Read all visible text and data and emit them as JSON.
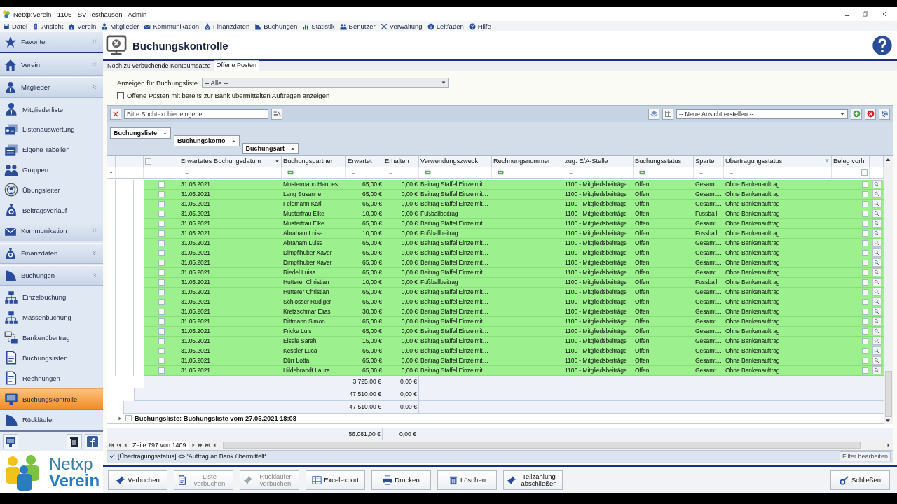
{
  "window": {
    "title": "Netxp:Verein - 1105 - SV Testhausen - Admin"
  },
  "menu": [
    "Datei",
    "Ansicht",
    "Verein",
    "Mitglieder",
    "Kommunikation",
    "Finanzdaten",
    "Buchungen",
    "Statistik",
    "Benutzer",
    "Verwaltung",
    "Leitfäden",
    "Hilfe"
  ],
  "sidebar": {
    "sections": [
      {
        "label": "Favoriten",
        "expanded": false
      },
      {
        "label": "Verein",
        "expanded": false
      },
      {
        "label": "Mitglieder",
        "expanded": true,
        "items": [
          {
            "label": "Mitgliederliste",
            "selected": false
          },
          {
            "label": "Listenauswertung",
            "selected": false
          },
          {
            "label": "Eigene Tabellen",
            "selected": false
          },
          {
            "label": "Gruppen",
            "selected": false
          },
          {
            "label": "Übungsleiter",
            "selected": false
          },
          {
            "label": "Beitragsverlauf",
            "selected": false
          }
        ]
      },
      {
        "label": "Kommunikation",
        "expanded": false
      },
      {
        "label": "Finanzdaten",
        "expanded": false
      },
      {
        "label": "Buchungen",
        "expanded": true,
        "items": [
          {
            "label": "Einzelbuchung",
            "selected": false
          },
          {
            "label": "Massenbuchung",
            "selected": false
          },
          {
            "label": "Bankenübertrag",
            "selected": false
          },
          {
            "label": "Buchungslisten",
            "selected": false
          },
          {
            "label": "Rechnungen",
            "selected": false
          },
          {
            "label": "Buchungskontrolle",
            "selected": true
          },
          {
            "label": "Rückläufer",
            "selected": false
          }
        ]
      }
    ]
  },
  "logo": {
    "top": "Netxp",
    "bottom": "Verein"
  },
  "page": {
    "title": "Buchungskontrolle"
  },
  "tabs": [
    {
      "label": "Noch zu verbuchende Kontoumsätze",
      "selected": false
    },
    {
      "label": "Offene Posten",
      "selected": true
    }
  ],
  "filter": {
    "label": "Anzeigen für Buchungsliste",
    "value": "-- Alle --"
  },
  "option": {
    "label": "Offene Posten mit bereits zur Bank übermittelten Aufträgen anzeigen",
    "checked": false
  },
  "search": {
    "placeholder": "Bitte Suchtext hier eingeben..."
  },
  "view_select": {
    "value": "-- Neue Ansicht erstellen --"
  },
  "group_by": [
    "Buchungsliste",
    "Buchungskonto",
    "Buchungsart"
  ],
  "table": {
    "all_checked": false,
    "columns": [
      {
        "label": "Erwartetes Buchungsdatum",
        "sorted": true,
        "filtered": false,
        "filter": {
          "kind": "operator",
          "text": "="
        }
      },
      {
        "label": "Buchungspartner",
        "sorted": false,
        "filtered": false,
        "filter": {
          "kind": "contains"
        }
      },
      {
        "label": "Erwartet",
        "sorted": false,
        "filtered": false,
        "filter": {
          "kind": "operator",
          "text": "="
        }
      },
      {
        "label": "Erhalten",
        "sorted": false,
        "filtered": false,
        "filter": {
          "kind": "operator",
          "text": "="
        }
      },
      {
        "label": "Verwendungszweck",
        "sorted": false,
        "filtered": false,
        "filter": {
          "kind": "contains"
        }
      },
      {
        "label": "Rechnungsnummer",
        "sorted": false,
        "filtered": false,
        "filter": {
          "kind": "contains"
        }
      },
      {
        "label": "zug. E/A-Stelle",
        "sorted": false,
        "filtered": false,
        "filter": {
          "kind": "operator",
          "text": "="
        }
      },
      {
        "label": "Buchungsstatus",
        "sorted": false,
        "filtered": false,
        "filter": {
          "kind": "contains"
        }
      },
      {
        "label": "Sparte",
        "sorted": false,
        "filtered": false,
        "filter": {
          "kind": "operator",
          "text": "="
        }
      },
      {
        "label": "Übertragungsstatus",
        "sorted": false,
        "filtered": true,
        "filter": {
          "kind": "operator",
          "text": "="
        }
      },
      {
        "label": "Beleg vorh",
        "sorted": false,
        "filtered": false,
        "filter": {
          "kind": "checkbox",
          "checked": false
        }
      }
    ],
    "rows": [
      {
        "checked": false,
        "date": "31.05.2021",
        "partner": "Mustermann Hannes",
        "expected": "65,00 €",
        "received": "0,00 €",
        "purpose": "Beitrag Staffel Einzelmit…",
        "account": "1100 - Mitgliedsbeiträge",
        "status": "Offen",
        "division": "Gesamt…",
        "transfer": "Ohne Bankenauftrag",
        "document": false
      },
      {
        "checked": false,
        "date": "31.05.2021",
        "partner": "Lang Susanne",
        "expected": "65,00 €",
        "received": "0,00 €",
        "purpose": "Beitrag Staffel Einzelmit…",
        "account": "1100 - Mitgliedsbeiträge",
        "status": "Offen",
        "division": "Gesamt…",
        "transfer": "Ohne Bankenauftrag",
        "document": false
      },
      {
        "checked": false,
        "date": "31.05.2021",
        "partner": "Feldmann Karl",
        "expected": "65,00 €",
        "received": "0,00 €",
        "purpose": "Beitrag Staffel Einzelmit…",
        "account": "1100 - Mitgliedsbeiträge",
        "status": "Offen",
        "division": "Gesamt…",
        "transfer": "Ohne Bankenauftrag",
        "document": false
      },
      {
        "checked": false,
        "date": "31.05.2021",
        "partner": "Musterfrau Elke",
        "expected": "10,00 €",
        "received": "0,00 €",
        "purpose": "Fußballbeitrag",
        "account": "1100 - Mitgliedsbeiträge",
        "status": "Offen",
        "division": "Fussball",
        "transfer": "Ohne Bankenauftrag",
        "document": false
      },
      {
        "checked": false,
        "date": "31.05.2021",
        "partner": "Musterfrau Elke",
        "expected": "65,00 €",
        "received": "0,00 €",
        "purpose": "Beitrag Staffel Einzelmit…",
        "account": "1100 - Mitgliedsbeiträge",
        "status": "Offen",
        "division": "Gesamt…",
        "transfer": "Ohne Bankenauftrag",
        "document": false
      },
      {
        "checked": false,
        "date": "31.05.2021",
        "partner": "Abraham Luise",
        "expected": "10,00 €",
        "received": "0,00 €",
        "purpose": "Fußballbeitrag",
        "account": "1100 - Mitgliedsbeiträge",
        "status": "Offen",
        "division": "Fussball",
        "transfer": "Ohne Bankenauftrag",
        "document": false
      },
      {
        "checked": false,
        "date": "31.05.2021",
        "partner": "Abraham Luise",
        "expected": "65,00 €",
        "received": "0,00 €",
        "purpose": "Beitrag Staffel Einzelmit…",
        "account": "1100 - Mitgliedsbeiträge",
        "status": "Offen",
        "division": "Gesamt…",
        "transfer": "Ohne Bankenauftrag",
        "document": false
      },
      {
        "checked": false,
        "date": "31.05.2021",
        "partner": "Dimpflhuber Xaver",
        "expected": "65,00 €",
        "received": "0,00 €",
        "purpose": "Beitrag Staffel Einzelmit…",
        "account": "1100 - Mitgliedsbeiträge",
        "status": "Offen",
        "division": "Gesamt…",
        "transfer": "Ohne Bankenauftrag",
        "document": false
      },
      {
        "checked": false,
        "date": "31.05.2021",
        "partner": "Dimpflhuber Xaver",
        "expected": "65,00 €",
        "received": "0,00 €",
        "purpose": "Beitrag Staffel Einzelmit…",
        "account": "1100 - Mitgliedsbeiträge",
        "status": "Offen",
        "division": "Gesamt…",
        "transfer": "Ohne Bankenauftrag",
        "document": false
      },
      {
        "checked": false,
        "date": "31.05.2021",
        "partner": "Riedel Luisa",
        "expected": "65,00 €",
        "received": "0,00 €",
        "purpose": "Beitrag Staffel Einzelmit…",
        "account": "1100 - Mitgliedsbeiträge",
        "status": "Offen",
        "division": "Gesamt…",
        "transfer": "Ohne Bankenauftrag",
        "document": false
      },
      {
        "checked": false,
        "date": "31.05.2021",
        "partner": "Hutterer Christian",
        "expected": "10,00 €",
        "received": "0,00 €",
        "purpose": "Fußballbeitrag",
        "account": "1100 - Mitgliedsbeiträge",
        "status": "Offen",
        "division": "Fussball",
        "transfer": "Ohne Bankenauftrag",
        "document": false
      },
      {
        "checked": false,
        "date": "31.05.2021",
        "partner": "Hutterer Christian",
        "expected": "65,00 €",
        "received": "0,00 €",
        "purpose": "Beitrag Staffel Einzelmit…",
        "account": "1100 - Mitgliedsbeiträge",
        "status": "Offen",
        "division": "Gesamt…",
        "transfer": "Ohne Bankenauftrag",
        "document": false
      },
      {
        "checked": false,
        "date": "31.05.2021",
        "partner": "Schlosser Rüdiger",
        "expected": "65,00 €",
        "received": "0,00 €",
        "purpose": "Beitrag Staffel Einzelmit…",
        "account": "1100 - Mitgliedsbeiträge",
        "status": "Offen",
        "division": "Gesamt…",
        "transfer": "Ohne Bankenauftrag",
        "document": false
      },
      {
        "checked": false,
        "date": "31.05.2021",
        "partner": "Kretzschmar Elias",
        "expected": "30,00 €",
        "received": "0,00 €",
        "purpose": "Beitrag Staffel Einzelmit…",
        "account": "1100 - Mitgliedsbeiträge",
        "status": "Offen",
        "division": "Gesamt…",
        "transfer": "Ohne Bankenauftrag",
        "document": false
      },
      {
        "checked": false,
        "date": "31.05.2021",
        "partner": "Dittmann Simon",
        "expected": "65,00 €",
        "received": "0,00 €",
        "purpose": "Beitrag Staffel Einzelmit…",
        "account": "1100 - Mitgliedsbeiträge",
        "status": "Offen",
        "division": "Gesamt…",
        "transfer": "Ohne Bankenauftrag",
        "document": false
      },
      {
        "checked": false,
        "date": "31.05.2021",
        "partner": "Fricke Luis",
        "expected": "65,00 €",
        "received": "0,00 €",
        "purpose": "Beitrag Staffel Einzelmit…",
        "account": "1100 - Mitgliedsbeiträge",
        "status": "Offen",
        "division": "Gesamt…",
        "transfer": "Ohne Bankenauftrag",
        "document": false
      },
      {
        "checked": false,
        "date": "31.05.2021",
        "partner": "Eisele Sarah",
        "expected": "15,00 €",
        "received": "0,00 €",
        "purpose": "Beitrag Staffel Einzelmit…",
        "account": "1100 - Mitgliedsbeiträge",
        "status": "Offen",
        "division": "Gesamt…",
        "transfer": "Ohne Bankenauftrag",
        "document": false
      },
      {
        "checked": false,
        "date": "31.05.2021",
        "partner": "Kessler Luca",
        "expected": "65,00 €",
        "received": "0,00 €",
        "purpose": "Beitrag Staffel Einzelmit…",
        "account": "1100 - Mitgliedsbeiträge",
        "status": "Offen",
        "division": "Gesamt…",
        "transfer": "Ohne Bankenauftrag",
        "document": false
      },
      {
        "checked": false,
        "date": "31.05.2021",
        "partner": "Dürr Lotta",
        "expected": "65,00 €",
        "received": "0,00 €",
        "purpose": "Beitrag Staffel Einzelmit…",
        "account": "1100 - Mitgliedsbeiträge",
        "status": "Offen",
        "division": "Gesamt…",
        "transfer": "Ohne Bankenauftrag",
        "document": false
      },
      {
        "checked": false,
        "date": "31.05.2021",
        "partner": "Hildebrandt Laura",
        "expected": "65,00 €",
        "received": "0,00 €",
        "purpose": "Beitrag Staffel Einzelmit…",
        "account": "1100 - Mitgliedsbeiträge",
        "status": "Offen",
        "division": "Gesamt…",
        "transfer": "Ohne Bankenauftrag",
        "document": false
      }
    ],
    "group_totals": [
      {
        "expected": "3.725,00 €",
        "received": "0,00 €"
      },
      {
        "expected": "47.510,00 €",
        "received": "0,00 €"
      },
      {
        "expected": "47.510,00 €",
        "received": "0,00 €"
      }
    ],
    "collapsed_group": {
      "label": "Buchungsliste: Buchungsliste vom 27.05.2021 18:08",
      "expanded": false,
      "checked": false
    },
    "grand_total": {
      "expected": "56.081,00 €",
      "received": "0,00 €"
    }
  },
  "pager": {
    "text": "Zeile 797 von 1409"
  },
  "filter_bar": {
    "text": "[Übertragungsstatus] <> 'Auftrag an Bank übermittelt'",
    "active": true,
    "button": "Filter bearbeiten"
  },
  "actions": [
    {
      "label": "Verbuchen",
      "disabled": false
    },
    {
      "label": "Liste verbuchen",
      "disabled": true
    },
    {
      "label": "Rückläufer verbuchen",
      "disabled": true
    },
    {
      "label": "Excelexport",
      "disabled": false
    },
    {
      "label": "Drucken",
      "disabled": false
    },
    {
      "label": "Löschen",
      "disabled": false
    },
    {
      "label": "Teilzahlung abschließen",
      "disabled": false
    }
  ],
  "close_button": {
    "label": "Schließen"
  }
}
